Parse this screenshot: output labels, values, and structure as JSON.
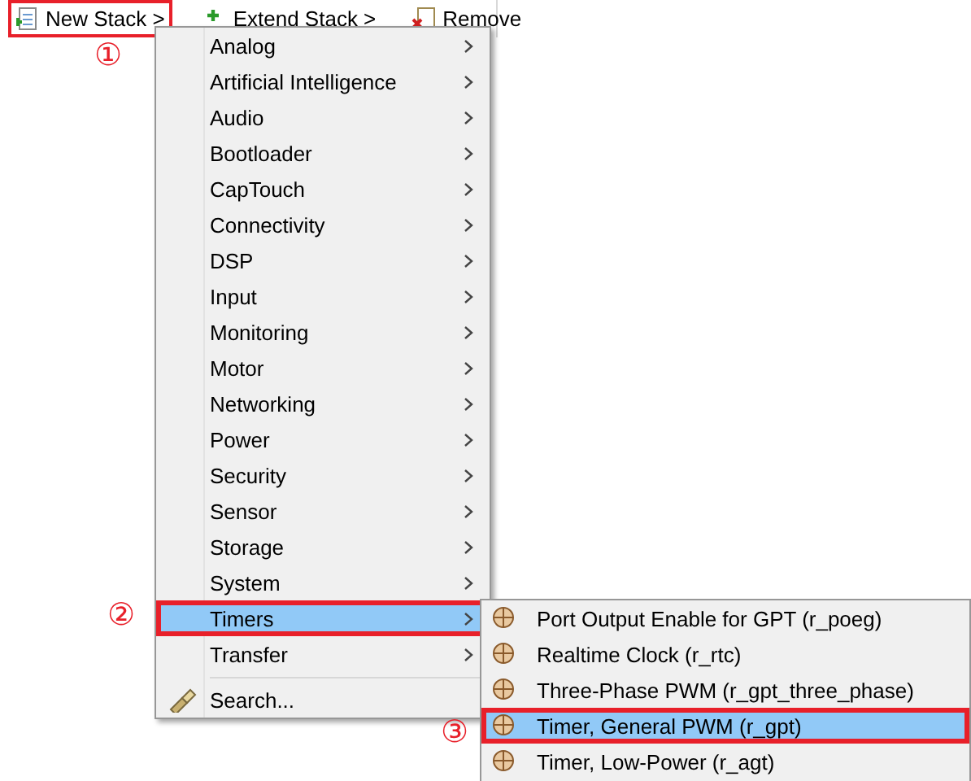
{
  "toolbar": {
    "buttons": [
      {
        "label": "New Stack >",
        "kind": "new",
        "callout": "①"
      },
      {
        "label": "Extend Stack >",
        "kind": "extend"
      },
      {
        "label": "Remove",
        "kind": "remove"
      }
    ]
  },
  "menu": {
    "items": [
      {
        "label": "Analog",
        "kind": "submenu",
        "selected": false
      },
      {
        "label": "Artificial Intelligence",
        "kind": "submenu",
        "selected": false
      },
      {
        "label": "Audio",
        "kind": "submenu",
        "selected": false
      },
      {
        "label": "Bootloader",
        "kind": "submenu",
        "selected": false
      },
      {
        "label": "CapTouch",
        "kind": "submenu",
        "selected": false
      },
      {
        "label": "Connectivity",
        "kind": "submenu",
        "selected": false
      },
      {
        "label": "DSP",
        "kind": "submenu",
        "selected": false
      },
      {
        "label": "Input",
        "kind": "submenu",
        "selected": false
      },
      {
        "label": "Monitoring",
        "kind": "submenu",
        "selected": false
      },
      {
        "label": "Motor",
        "kind": "submenu",
        "selected": false
      },
      {
        "label": "Networking",
        "kind": "submenu",
        "selected": false
      },
      {
        "label": "Power",
        "kind": "submenu",
        "selected": false
      },
      {
        "label": "Security",
        "kind": "submenu",
        "selected": false
      },
      {
        "label": "Sensor",
        "kind": "submenu",
        "selected": false
      },
      {
        "label": "Storage",
        "kind": "submenu",
        "selected": false
      },
      {
        "label": "System",
        "kind": "submenu",
        "selected": false
      },
      {
        "label": "Timers",
        "kind": "submenu",
        "selected": true,
        "callout": "②"
      },
      {
        "label": "Transfer",
        "kind": "submenu",
        "selected": false
      },
      {
        "label": "Search...",
        "kind": "search",
        "selected": false
      }
    ]
  },
  "submenu": {
    "items": [
      {
        "label": "Port Output Enable for GPT (r_poeg)",
        "selected": false
      },
      {
        "label": "Realtime Clock (r_rtc)",
        "selected": false
      },
      {
        "label": "Three-Phase PWM (r_gpt_three_phase)",
        "selected": false
      },
      {
        "label": "Timer, General PWM (r_gpt)",
        "selected": true,
        "callout": "③"
      },
      {
        "label": "Timer, Low-Power (r_agt)",
        "selected": false
      }
    ]
  }
}
